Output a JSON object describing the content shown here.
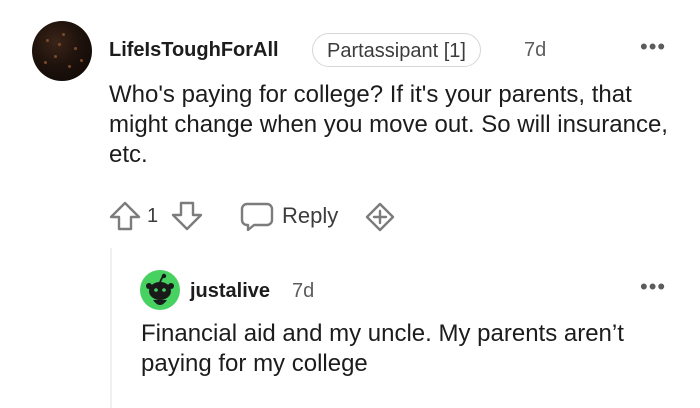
{
  "comment": {
    "username": "LifeIsToughForAll",
    "flair": "Partassipant [1]",
    "age": "7d",
    "more_label": "•••",
    "body": "Who's paying for college? If it's your parents, that might change when you move out. So will insurance, etc.",
    "score": "1",
    "reply_label": "Reply",
    "icons": {
      "upvote": "upvote-arrow-icon",
      "downvote": "downvote-arrow-icon",
      "reply": "speech-bubble-icon",
      "award": "award-plus-icon"
    }
  },
  "reply": {
    "username": "justalive",
    "age": "7d",
    "more_label": "•••",
    "body": "Financial aid and my uncle. My parents aren’t paying for my college",
    "avatar_color": "#46d160"
  }
}
